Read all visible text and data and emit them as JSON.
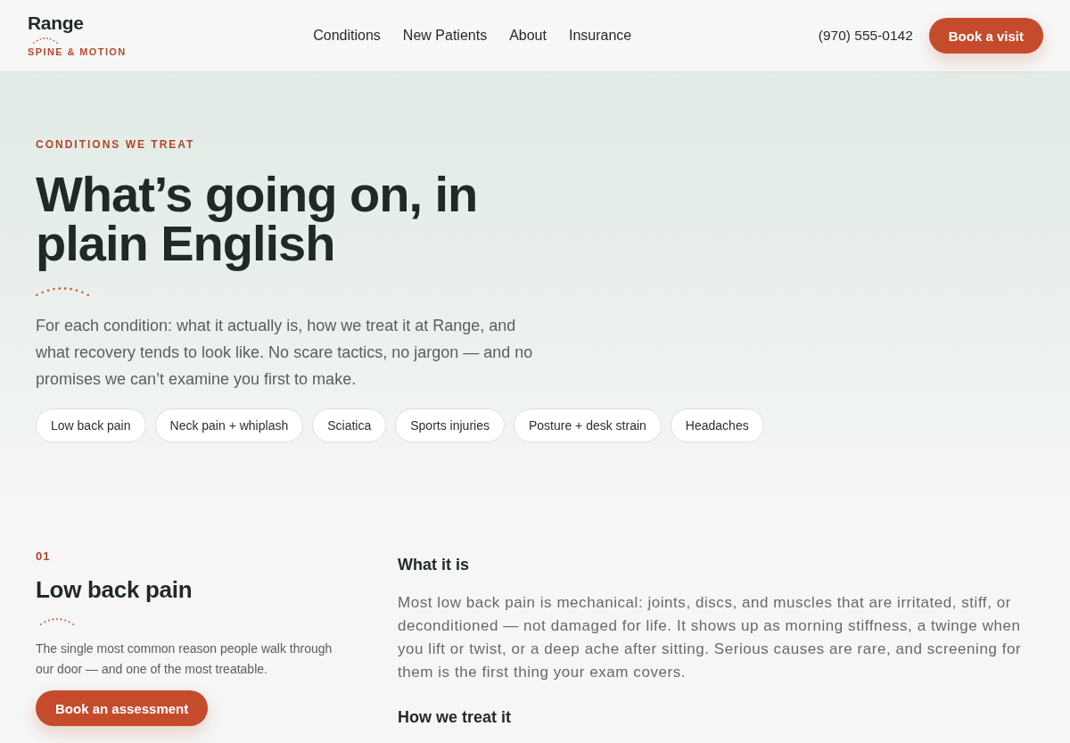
{
  "header": {
    "logo": {
      "name": "Range",
      "tagline": "SPINE & MOTION"
    },
    "nav": [
      "Conditions",
      "New Patients",
      "About",
      "Insurance"
    ],
    "phone": "(970) 555-0142",
    "cta": "Book a visit"
  },
  "hero": {
    "eyebrow": "CONDITIONS WE TREAT",
    "title": "What’s going on, in plain English",
    "intro": "For each condition: what it actually is, how we treat it at Range, and what recovery tends to look like. No scare tactics, no jargon — and no promises we can’t examine you first to make.",
    "chips": [
      "Low back pain",
      "Neck pain + whiplash",
      "Sciatica",
      "Sports injuries",
      "Posture + desk strain",
      "Headaches"
    ]
  },
  "conditions": [
    {
      "number": "01",
      "title": "Low back pain",
      "summary": "The single most common reason people walk through our door — and one of the most treatable.",
      "button": "Book an assessment",
      "sections": [
        {
          "heading": "What it is",
          "body": "Most low back pain is mechanical: joints, discs, and muscles that are irritated, stiff, or deconditioned — not damaged for life. It shows up as morning stiffness, a twinge when you lift or twist, or a deep ache after sitting. Serious causes are rare, and screening for them is the first thing your exam covers."
        },
        {
          "heading": "How we treat it"
        }
      ]
    }
  ]
}
